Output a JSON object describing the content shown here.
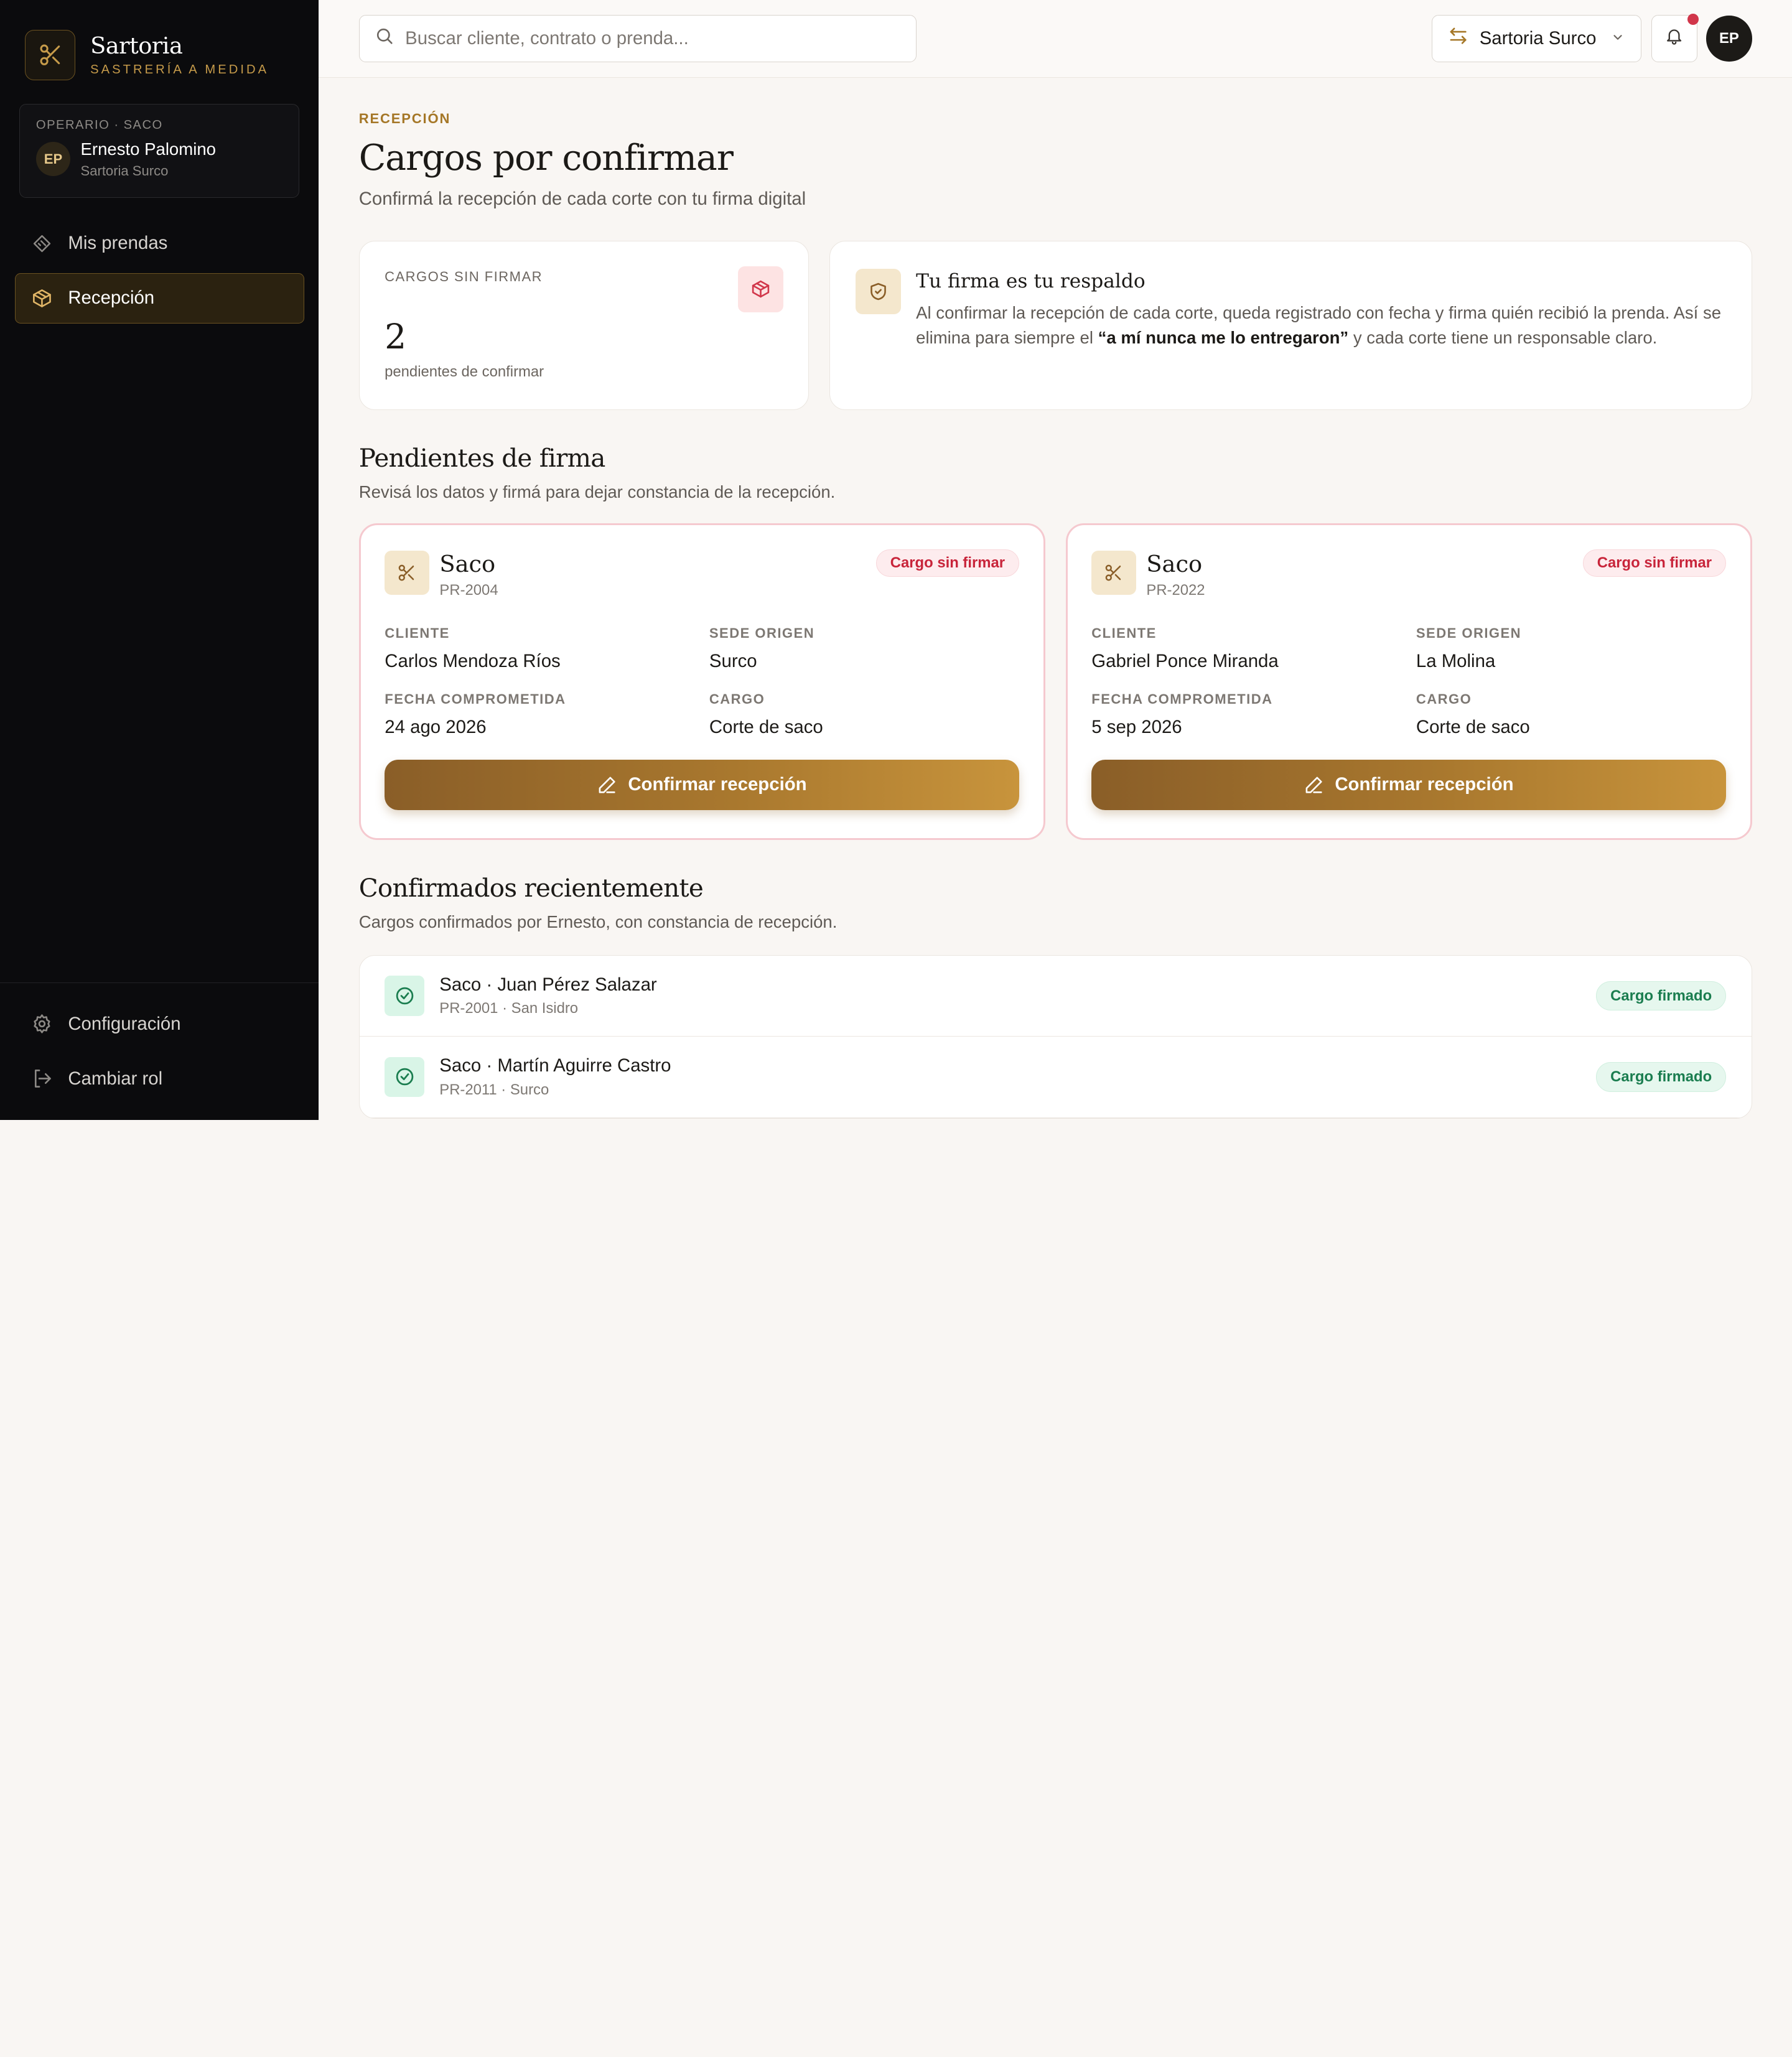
{
  "brand": {
    "name": "Sartoria",
    "tagline": "SASTRERÍA A MEDIDA"
  },
  "user": {
    "role": "OPERARIO · SACO",
    "initials": "EP",
    "name": "Ernesto Palomino",
    "site": "Sartoria Surco"
  },
  "nav": {
    "items": [
      {
        "label": "Mis prendas",
        "icon": "tag-icon",
        "active": false
      },
      {
        "label": "Recepción",
        "icon": "package-icon",
        "active": true
      }
    ],
    "bottom": [
      {
        "label": "Configuración",
        "icon": "gear-icon"
      },
      {
        "label": "Cambiar rol",
        "icon": "logout-icon"
      }
    ]
  },
  "topbar": {
    "search_placeholder": "Buscar cliente, contrato o prenda...",
    "site_selector": "Sartoria Surco",
    "avatar_initials": "EP"
  },
  "page": {
    "eyebrow": "RECEPCIÓN",
    "title": "Cargos por confirmar",
    "subtitle": "Confirmá la recepción de cada corte con tu firma digital"
  },
  "stat": {
    "label": "CARGOS SIN FIRMAR",
    "value": "2",
    "sub": "pendientes de confirmar"
  },
  "info": {
    "title": "Tu firma es tu respaldo",
    "text_before": "Al confirmar la recepción de cada corte, queda registrado con fecha y firma quién recibió la prenda. Así se elimina para siempre el ",
    "text_bold": "“a mí nunca me lo entregaron”",
    "text_after": " y cada corte tiene un responsable claro."
  },
  "pending": {
    "title": "Pendientes de firma",
    "subtitle": "Revisá los datos y firmá para dejar constancia de la recepción.",
    "labels": {
      "client": "CLIENTE",
      "site": "SEDE ORIGEN",
      "date": "FECHA COMPROMETIDA",
      "cargo": "CARGO"
    },
    "badge": "Cargo sin firmar",
    "button": "Confirmar recepción",
    "cards": [
      {
        "name": "Saco",
        "code": "PR-2004",
        "client": "Carlos Mendoza Ríos",
        "site": "Surco",
        "date": "24 ago 2026",
        "cargo": "Corte de saco"
      },
      {
        "name": "Saco",
        "code": "PR-2022",
        "client": "Gabriel Ponce Miranda",
        "site": "La Molina",
        "date": "5 sep 2026",
        "cargo": "Corte de saco"
      }
    ]
  },
  "recent": {
    "title": "Confirmados recientemente",
    "subtitle": "Cargos confirmados por Ernesto, con constancia de recepción.",
    "badge": "Cargo firmado",
    "items": [
      {
        "title": "Saco · Juan Pérez Salazar",
        "sub": "PR-2001 · San Isidro"
      },
      {
        "title": "Saco · Martín Aguirre Castro",
        "sub": "PR-2011 · Surco"
      }
    ]
  },
  "colors": {
    "accent": "#a57727",
    "danger": "#c8243a",
    "success": "#1a7d4f",
    "sidebar": "#0b0b0d"
  }
}
